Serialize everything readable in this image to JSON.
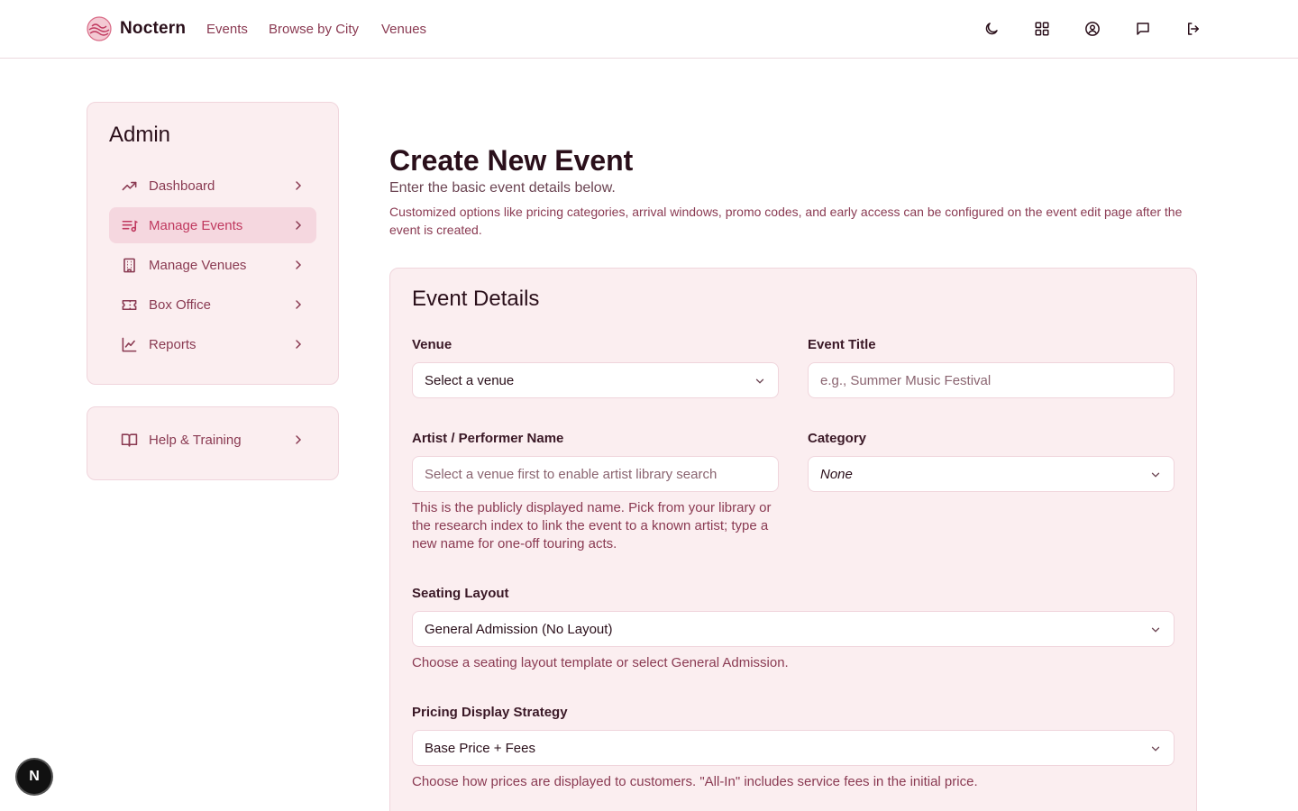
{
  "header": {
    "brand": "Noctern",
    "nav": [
      "Events",
      "Browse by City",
      "Venues"
    ],
    "icons": [
      "moon-icon",
      "grid-icon",
      "user-circle-icon",
      "message-icon",
      "logout-icon"
    ]
  },
  "sidebar": {
    "title": "Admin",
    "items": [
      {
        "label": "Dashboard",
        "icon": "trending-up-icon",
        "active": false
      },
      {
        "label": "Manage Events",
        "icon": "list-music-icon",
        "active": true
      },
      {
        "label": "Manage Venues",
        "icon": "building-icon",
        "active": false
      },
      {
        "label": "Box Office",
        "icon": "ticket-icon",
        "active": false
      },
      {
        "label": "Reports",
        "icon": "chart-icon",
        "active": false
      }
    ],
    "help": {
      "label": "Help & Training",
      "icon": "book-icon"
    }
  },
  "main": {
    "title": "Create New Event",
    "subtitle": "Enter the basic event details below.",
    "note": "Customized options like pricing categories, arrival windows, promo codes, and early access can be configured on the event edit page after the event is created.",
    "card_title": "Event Details",
    "fields": {
      "venue": {
        "label": "Venue",
        "value": "Select a venue"
      },
      "event_title": {
        "label": "Event Title",
        "placeholder": "e.g., Summer Music Festival"
      },
      "artist": {
        "label": "Artist / Performer Name",
        "placeholder": "Select a venue first to enable artist library search",
        "hint": "This is the publicly displayed name. Pick from your library or the research index to link the event to a known artist; type a new name for one-off touring acts."
      },
      "category": {
        "label": "Category",
        "value": "None"
      },
      "seating": {
        "label": "Seating Layout",
        "value": "General Admission (No Layout)",
        "hint": "Choose a seating layout template or select General Admission."
      },
      "pricing": {
        "label": "Pricing Display Strategy",
        "value": "Base Price + Fees",
        "hint": "Choose how prices are displayed to customers. \"All-In\" includes service fees in the initial price."
      }
    }
  },
  "floating_badge": "N",
  "colors": {
    "accent": "#c0395f",
    "muted": "#8a3a52",
    "card_bg": "#fbeef0"
  }
}
